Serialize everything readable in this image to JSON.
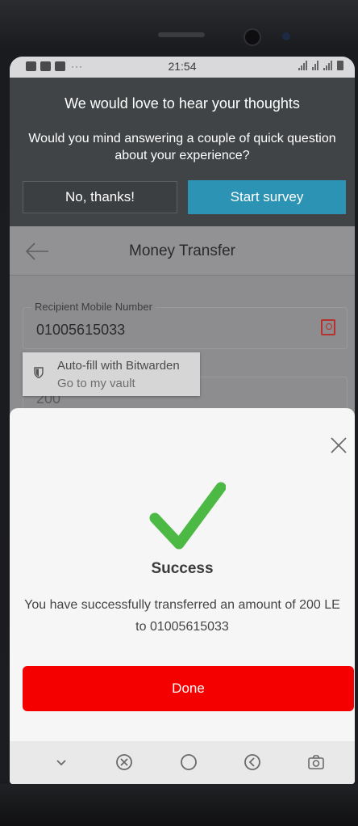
{
  "status_bar": {
    "time": "21:54"
  },
  "survey": {
    "title": "We would love to hear your thoughts",
    "text": "Would you mind answering a couple of quick question about your experience?",
    "decline_label": "No, thanks!",
    "start_label": "Start survey",
    "start_color": "#2c93b4"
  },
  "app": {
    "title": "Money Transfer",
    "recipient_field": {
      "label": "Recipient Mobile Number",
      "value": "01005615033"
    },
    "amount_field": {
      "value": "200"
    },
    "autofill": {
      "title": "Auto-fill with Bitwarden",
      "subtitle": "Go to my vault"
    }
  },
  "success_sheet": {
    "title": "Success",
    "message": "You have successfully transferred an amount of 200 LE to 01005615033",
    "done_label": "Done",
    "done_color": "#f40000",
    "check_color": "#4cb944"
  },
  "nav_icons": [
    "chevron-down-icon",
    "close-circle-icon",
    "home-circle-icon",
    "back-circle-icon",
    "camera-icon"
  ]
}
